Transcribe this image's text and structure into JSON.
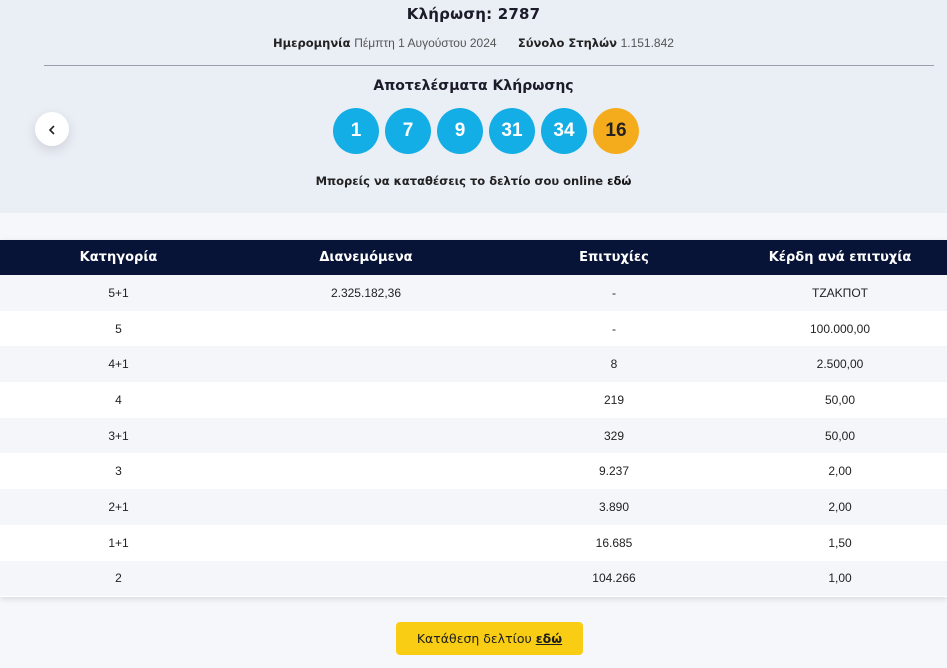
{
  "header": {
    "draw_title": "Κλήρωση: 2787",
    "date_label": "Ημερομηνία",
    "date_value": "Πέμπτη 1 Αυγούστου 2024",
    "columns_label": "Σύνολο Στηλών",
    "columns_value": "1.151.842"
  },
  "results": {
    "title": "Αποτελέσματα Κλήρωσης",
    "numbers": [
      "1",
      "7",
      "9",
      "31",
      "34"
    ],
    "bonus": "16",
    "online_text": "Μπορείς να καταθέσεις το δελτίο σου online",
    "online_link": "εδώ"
  },
  "table": {
    "headers": [
      "Κατηγορία",
      "Διανεμόμενα",
      "Επιτυχίες",
      "Κέρδη ανά επιτυχία"
    ],
    "rows": [
      [
        "5+1",
        "2.325.182,36",
        "-",
        "ΤΖΑΚΠΟΤ"
      ],
      [
        "5",
        "",
        "-",
        "100.000,00"
      ],
      [
        "4+1",
        "",
        "8",
        "2.500,00"
      ],
      [
        "4",
        "",
        "219",
        "50,00"
      ],
      [
        "3+1",
        "",
        "329",
        "50,00"
      ],
      [
        "3",
        "",
        "9.237",
        "2,00"
      ],
      [
        "2+1",
        "",
        "3.890",
        "2,00"
      ],
      [
        "1+1",
        "",
        "16.685",
        "1,50"
      ],
      [
        "2",
        "",
        "104.266",
        "1,00"
      ]
    ]
  },
  "cta": {
    "label": "Κατάθεση δελτίου",
    "link": "εδώ"
  },
  "colors": {
    "ball": "#14aee6",
    "bonus_ball": "#f5ac1c",
    "table_header": "#081338",
    "cta": "#f8cd14"
  },
  "icons": {
    "back": "chevron-left-icon"
  }
}
